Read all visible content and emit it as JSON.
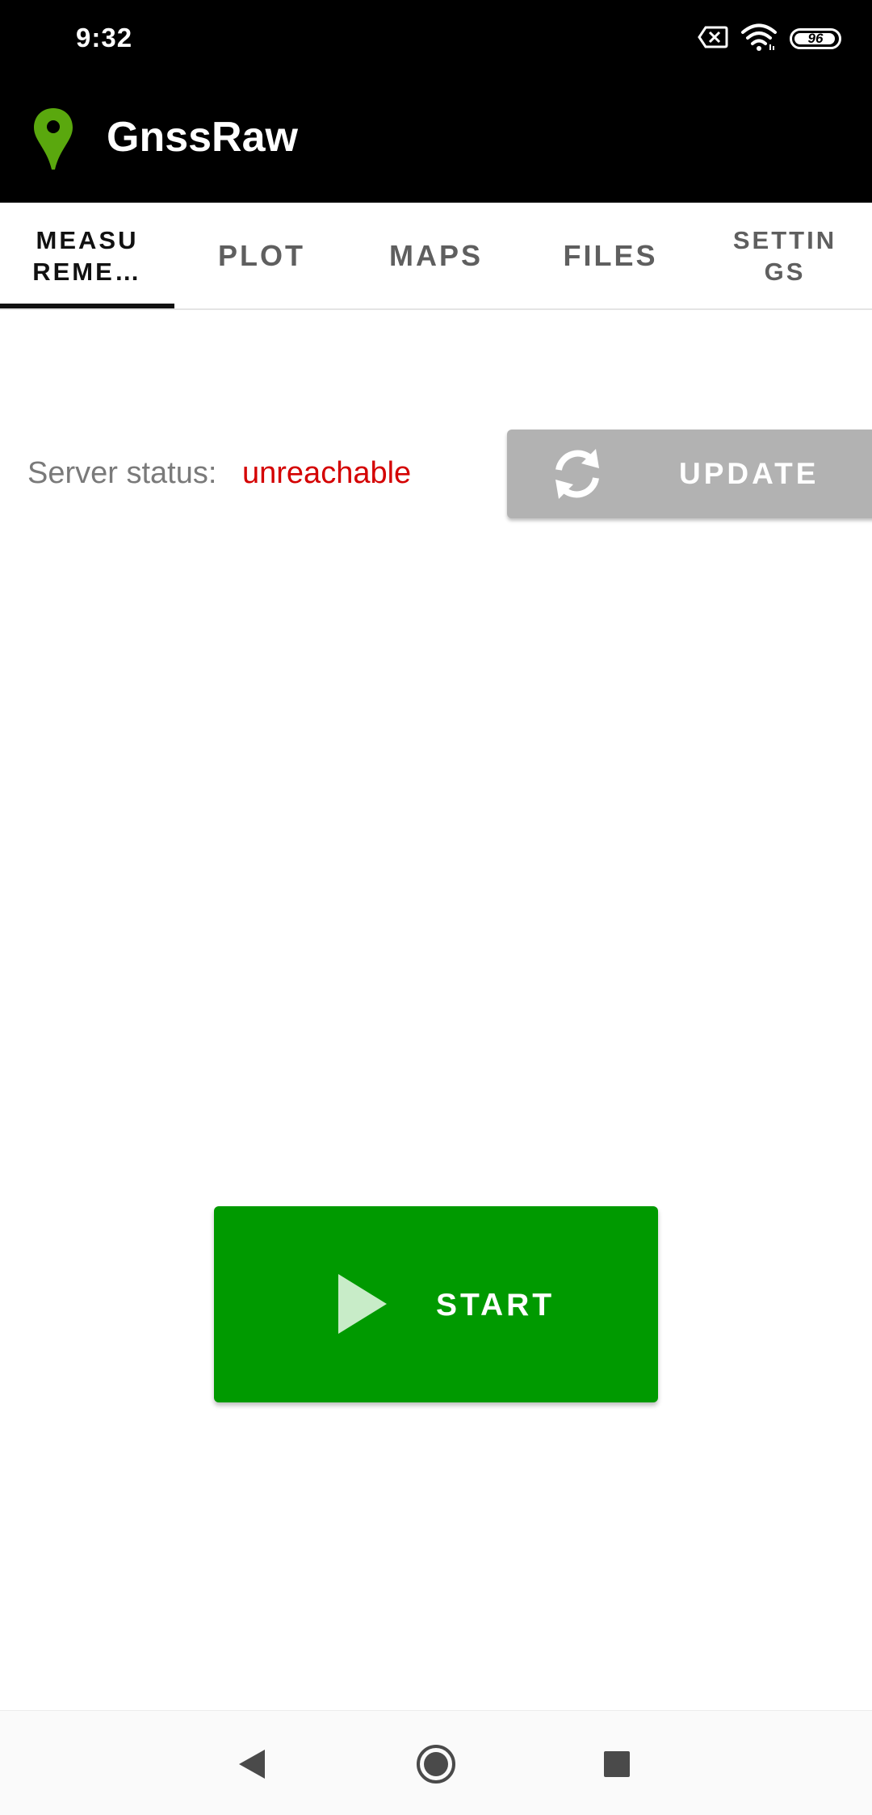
{
  "status_bar": {
    "time": "9:32",
    "battery_level": "96",
    "battery_percent": 96,
    "icons": [
      "sim-error-icon",
      "wifi-icon",
      "battery-icon"
    ]
  },
  "app_bar": {
    "title": "GnssRaw",
    "logo_icon": "location-pin-icon",
    "logo_color": "#5aa80e"
  },
  "tabs": [
    {
      "label": "MEASU\nREME…",
      "active": true
    },
    {
      "label": "PLOT",
      "active": false
    },
    {
      "label": "MAPS",
      "active": false
    },
    {
      "label": "FILES",
      "active": false
    },
    {
      "label": "SETTIN\nGS",
      "active": false
    }
  ],
  "server": {
    "label": "Server status:",
    "value": "unreachable",
    "value_color": "#d40000"
  },
  "update_button": {
    "label": "UPDATE",
    "icon": "refresh-icon"
  },
  "start_button": {
    "label": "START",
    "icon": "play-icon",
    "color": "#009a00"
  },
  "nav_bar": {
    "icons": [
      "back-icon",
      "home-icon",
      "recents-icon"
    ]
  }
}
